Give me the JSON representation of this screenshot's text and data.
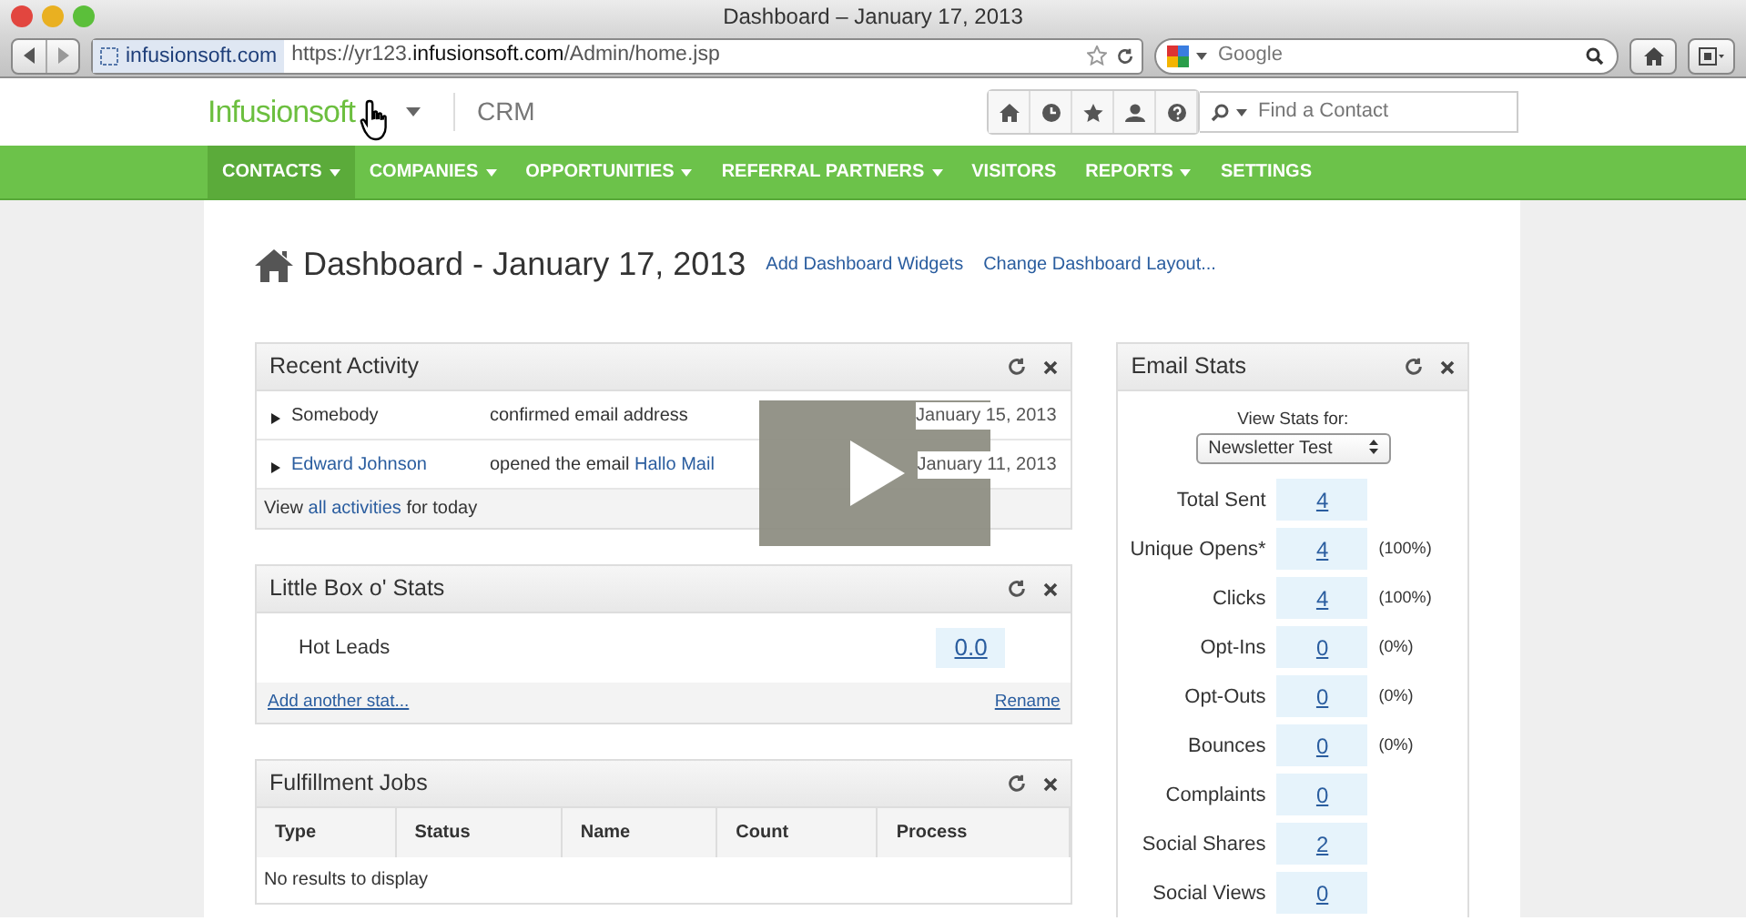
{
  "window": {
    "title": "Dashboard – January 17, 2013"
  },
  "browser": {
    "site_badge": "infusionsoft.com",
    "url": "https://yr123.**infusionsoft.com**/Admin/home.jsp",
    "search_placeholder": "Google"
  },
  "app": {
    "logo": "Infusionsoft",
    "app_name": "CRM",
    "contact_search": {
      "placeholder": "Find a Contact"
    }
  },
  "nav": [
    {
      "label": "CONTACTS",
      "has_menu": true,
      "selected": true
    },
    {
      "label": "COMPANIES",
      "has_menu": true,
      "selected": false
    },
    {
      "label": "OPPORTUNITIES",
      "has_menu": true,
      "selected": false
    },
    {
      "label": "REFERRAL PARTNERS",
      "has_menu": true,
      "selected": false
    },
    {
      "label": "VISITORS",
      "has_menu": false,
      "selected": false
    },
    {
      "label": "REPORTS",
      "has_menu": true,
      "selected": false
    },
    {
      "label": "SETTINGS",
      "has_menu": false,
      "selected": false
    }
  ],
  "heading": "Dashboard - January 17, 2013",
  "heading_links": [
    "Add Dashboard Widgets",
    "Change Dashboard Layout..."
  ],
  "recent_activity": {
    "title": "Recent Activity",
    "rows": [
      {
        "who": "Somebody",
        "who_is_link": false,
        "action": "confirmed email address",
        "action_link": "",
        "date": "January 15, 2013"
      },
      {
        "who": "Edward Johnson",
        "who_is_link": true,
        "action": "opened the email",
        "action_link": "Hallo Mail",
        "date": "January 11, 2013"
      }
    ],
    "footer": {
      "prefix": "View",
      "link": "all activities",
      "suffix": "for today"
    }
  },
  "little_box": {
    "title": "Little Box o' Stats",
    "stats": [
      {
        "label": "Hot Leads",
        "value": "0.0"
      }
    ],
    "add_link": "Add another stat...",
    "rename_link": "Rename"
  },
  "fulfillment": {
    "title": "Fulfillment Jobs",
    "columns": [
      "Type",
      "Status",
      "Name",
      "Count",
      "Process"
    ],
    "empty": "No results to display"
  },
  "email_stats": {
    "title": "Email Stats",
    "view_label": "View Stats for:",
    "selected_email": "Newsletter Test",
    "rows": [
      {
        "label": "Total Sent",
        "value": "4",
        "percent": ""
      },
      {
        "label": "Unique Opens*",
        "value": "4",
        "percent": "(100%)"
      },
      {
        "label": "Clicks",
        "value": "4",
        "percent": "(100%)"
      },
      {
        "label": "Opt-Ins",
        "value": "0",
        "percent": "(0%)"
      },
      {
        "label": "Opt-Outs",
        "value": "0",
        "percent": "(0%)"
      },
      {
        "label": "Bounces",
        "value": "0",
        "percent": "(0%)"
      },
      {
        "label": "Complaints",
        "value": "0",
        "percent": ""
      },
      {
        "label": "Social Shares",
        "value": "2",
        "percent": ""
      },
      {
        "label": "Social Views",
        "value": "0",
        "percent": ""
      }
    ]
  }
}
